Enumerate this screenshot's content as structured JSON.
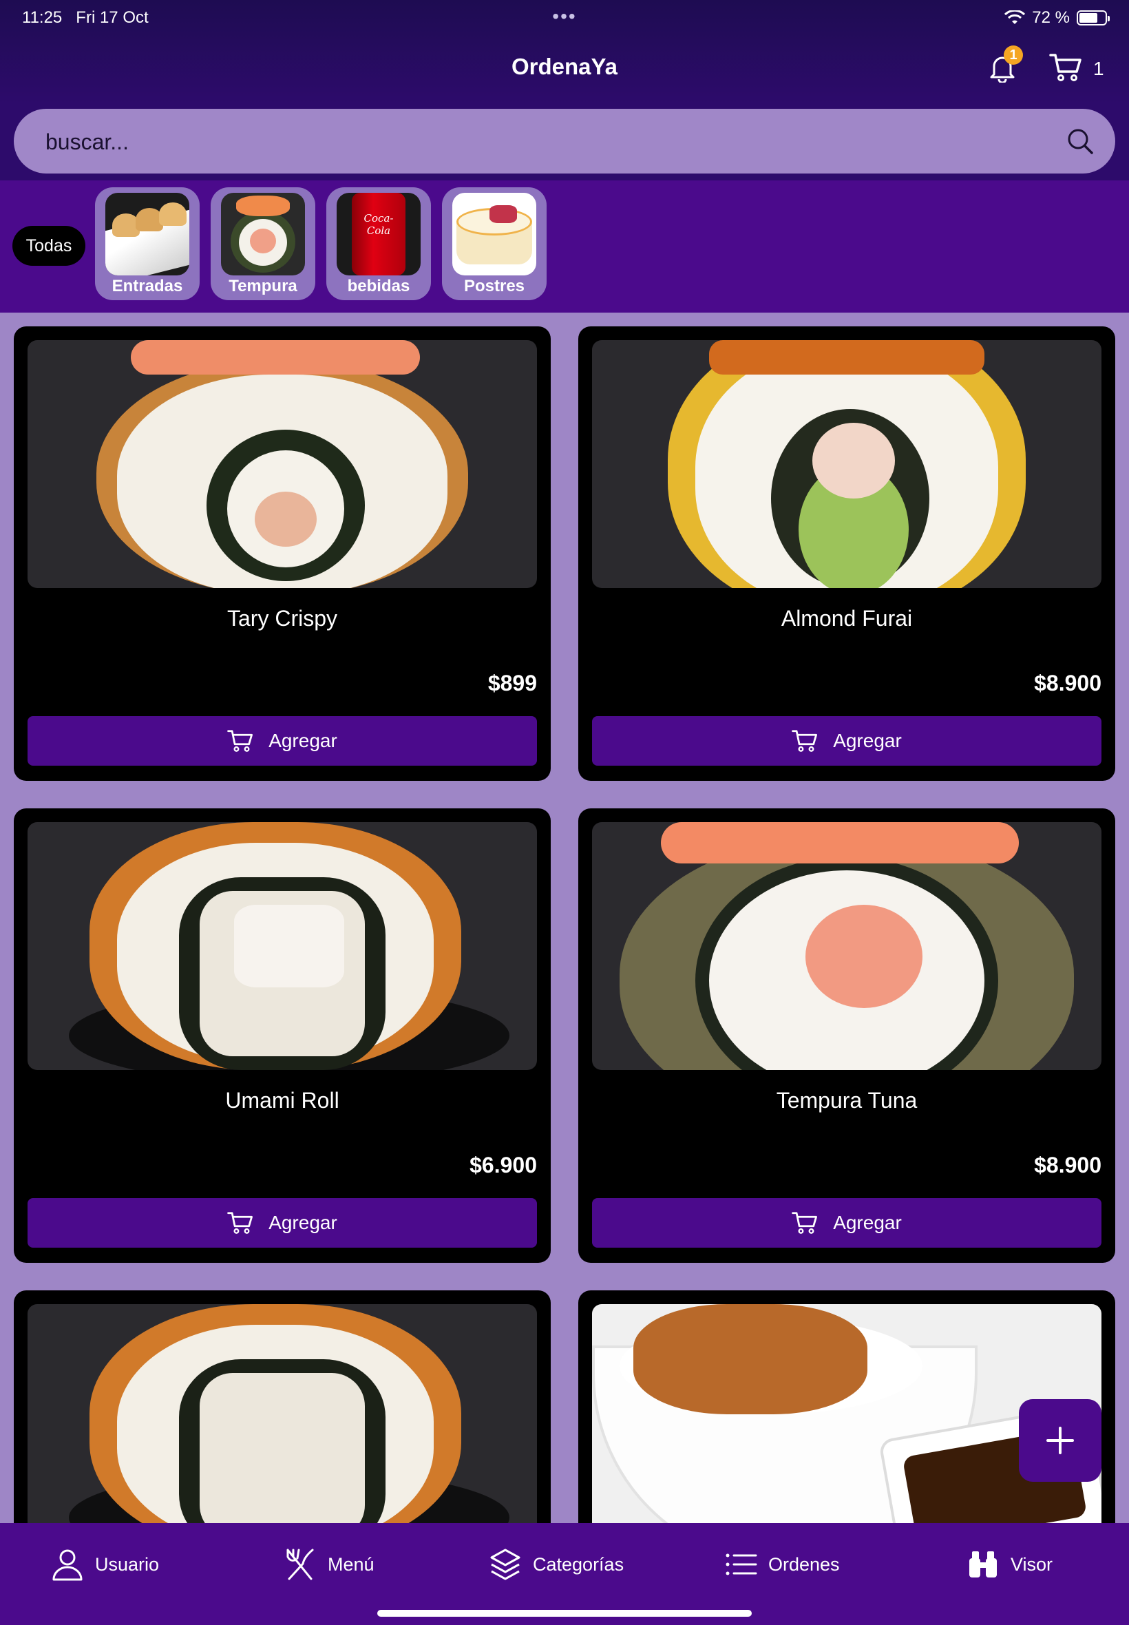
{
  "status": {
    "time": "11:25",
    "date": "Fri 17 Oct",
    "dots": "•••",
    "battery": "72 %"
  },
  "header": {
    "title": "OrdenaYa",
    "notification_count": "1",
    "cart_count": "1"
  },
  "search": {
    "placeholder": "buscar..."
  },
  "categories": {
    "all_label": "Todas",
    "items": [
      {
        "label": "Entradas"
      },
      {
        "label": "Tempura"
      },
      {
        "label": "bebidas"
      },
      {
        "label": "Postres"
      }
    ]
  },
  "products": [
    {
      "name": "Tary Crispy",
      "price": "$899",
      "add_label": "Agregar"
    },
    {
      "name": "Almond Furai",
      "price": "$8.900",
      "add_label": "Agregar"
    },
    {
      "name": "Umami Roll",
      "price": "$6.900",
      "add_label": "Agregar"
    },
    {
      "name": "Tempura Tuna",
      "price": "$8.900",
      "add_label": "Agregar"
    }
  ],
  "bottom_nav": [
    {
      "label": "Usuario",
      "icon": "user-icon"
    },
    {
      "label": "Menú",
      "icon": "utensils-icon"
    },
    {
      "label": "Categorías",
      "icon": "layers-icon"
    },
    {
      "label": "Ordenes",
      "icon": "list-icon"
    },
    {
      "label": "Visor",
      "icon": "binoculars-icon"
    }
  ],
  "colors": {
    "header": "#2d0b6b",
    "accent": "#4b0a8c",
    "background": "#9e86c6",
    "badge": "#f5a623"
  }
}
